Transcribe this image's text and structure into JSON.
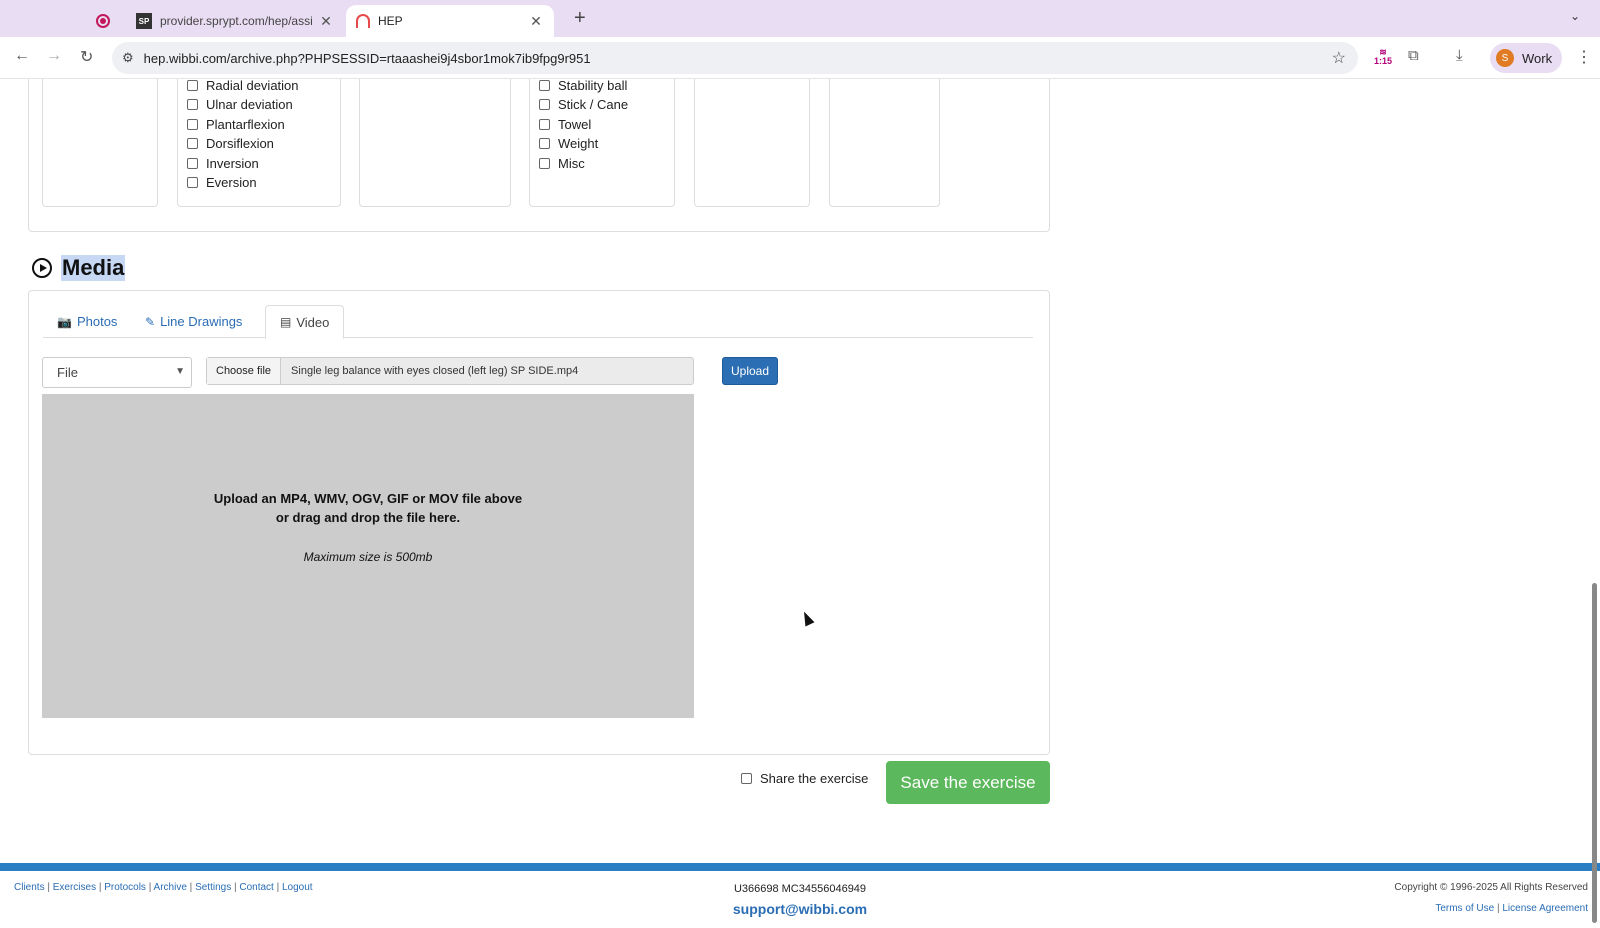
{
  "browser": {
    "tabs": [
      {
        "title": "provider.sprypt.com/hep/assi"
      },
      {
        "title": "HEP"
      }
    ],
    "url": "hep.wibbi.com/archive.php?PHPSESSID=rtaaashei9j4sbor1mok7ib9fpg9r951",
    "extension_badge": "1:15",
    "profile": {
      "initial": "S",
      "name": "Work"
    }
  },
  "filters": {
    "movement": [
      "Radial deviation",
      "Ulnar deviation",
      "Plantarflexion",
      "Dorsiflexion",
      "Inversion",
      "Eversion"
    ],
    "equipment": [
      "Stability ball",
      "Stick / Cane",
      "Towel",
      "Weight",
      "Misc"
    ]
  },
  "media": {
    "title": "Media",
    "tabs": [
      {
        "label": "Photos",
        "icon": "camera-icon"
      },
      {
        "label": "Line Drawings",
        "icon": "edit-icon"
      },
      {
        "label": "Video",
        "icon": "film-icon"
      }
    ],
    "active_tab": "Video",
    "source_select": "File",
    "choose_file_label": "Choose file",
    "file_name": "Single leg balance with eyes closed (left leg) SP SIDE.mp4",
    "upload_label": "Upload",
    "dropzone": {
      "line1": "Upload an MP4, WMV, OGV, GIF or MOV file above",
      "line2": "or drag and drop the file here.",
      "max_size": "Maximum size is 500mb"
    }
  },
  "actions": {
    "share_label": "Share the exercise",
    "save_label": "Save the exercise"
  },
  "footer": {
    "links": [
      "Clients",
      "Exercises",
      "Protocols",
      "Archive",
      "Settings",
      "Contact",
      "Logout"
    ],
    "codes": "U366698 MC34556046949",
    "email": "support@wibbi.com",
    "copyright": "Copyright © 1996-2025 All Rights Reserved",
    "terms": "Terms of Use",
    "license": "License Agreement"
  }
}
